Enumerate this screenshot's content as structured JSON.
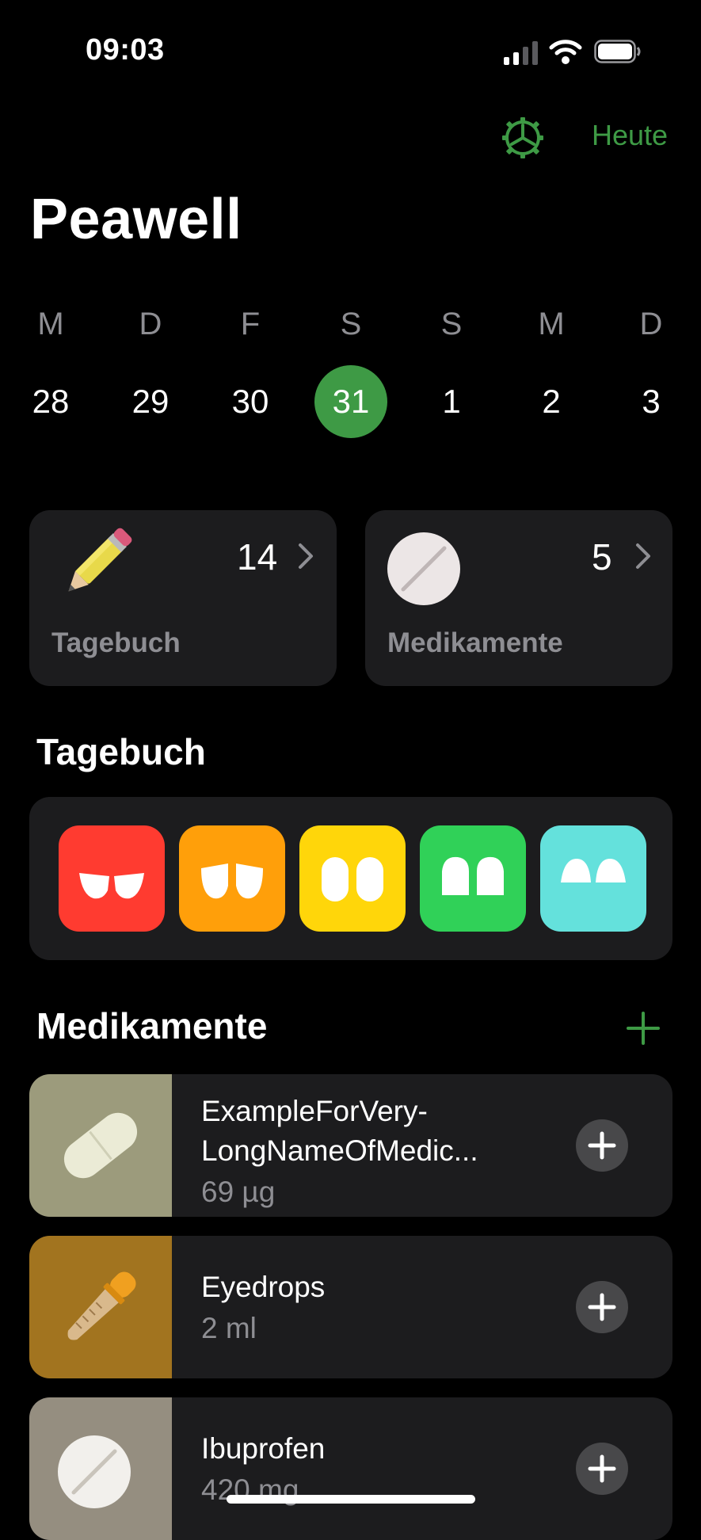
{
  "status_bar": {
    "time": "09:03"
  },
  "nav": {
    "today_label": "Heute"
  },
  "app_title": "Peawell",
  "week": [
    {
      "dow": "M",
      "date": "28",
      "selected": false
    },
    {
      "dow": "D",
      "date": "29",
      "selected": false
    },
    {
      "dow": "F",
      "date": "30",
      "selected": false
    },
    {
      "dow": "S",
      "date": "31",
      "selected": true
    },
    {
      "dow": "S",
      "date": "1",
      "selected": false
    },
    {
      "dow": "M",
      "date": "2",
      "selected": false
    },
    {
      "dow": "D",
      "date": "3",
      "selected": false
    }
  ],
  "summary": {
    "diary": {
      "label": "Tagebuch",
      "count": "14",
      "icon": "pencil-icon"
    },
    "medications": {
      "label": "Medikamente",
      "count": "5",
      "icon": "pill-icon"
    }
  },
  "diary_section": {
    "title": "Tagebuch",
    "moods": [
      {
        "name": "very-bad",
        "color": "#ff3b30"
      },
      {
        "name": "bad",
        "color": "#ff9f0a"
      },
      {
        "name": "neutral",
        "color": "#ffd60a"
      },
      {
        "name": "good",
        "color": "#30d158"
      },
      {
        "name": "very-good",
        "color": "#64e1dc"
      }
    ]
  },
  "medications_section": {
    "title": "Medikamente",
    "items": [
      {
        "name_line1": "ExampleForVery-",
        "name_line2": "LongNameOfMedic...",
        "dose": "69 µg",
        "thumb_color": "#9c9b7c",
        "icon": "capsule-icon"
      },
      {
        "name_line1": "Eyedrops",
        "dose": "2 ml",
        "thumb_color": "#a2741f",
        "icon": "dropper-icon"
      },
      {
        "name_line1": "Ibuprofen",
        "dose": "420 mg",
        "thumb_color": "#958e80",
        "icon": "tablet-icon"
      }
    ]
  },
  "colors": {
    "accent": "#3e9a45",
    "card": "#1c1c1e",
    "secondary_text": "#8e8e93"
  }
}
